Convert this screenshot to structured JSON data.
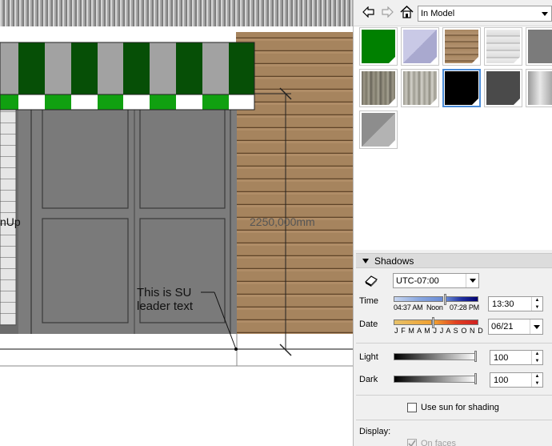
{
  "viewport": {
    "leader_text_line1": "This is SU",
    "leader_text_line2": "leader text",
    "dimension_label": "2250,000mm",
    "partial_label": "nUp"
  },
  "materials": {
    "collection": "In Model",
    "swatches": [
      {
        "name": "green",
        "color": "#008000"
      },
      {
        "name": "lavender",
        "color": "#b5b5da"
      },
      {
        "name": "wood",
        "color": "#a58463"
      },
      {
        "name": "siding",
        "color": "#e2e2e2"
      },
      {
        "name": "gray-partial",
        "color": "#7b7b7b"
      },
      {
        "name": "stone-1",
        "color": "#8a8676"
      },
      {
        "name": "stone-2",
        "color": "#b9b7ae"
      },
      {
        "name": "black",
        "color": "#000000"
      },
      {
        "name": "dark-gray",
        "color": "#4a4a4a"
      },
      {
        "name": "metal",
        "color": "#c5c5c5"
      },
      {
        "name": "gray",
        "color": "#8d8d8d"
      }
    ]
  },
  "shadows": {
    "title": "Shadows",
    "timezone": "UTC-07:00",
    "time_label": "Time",
    "time_marks": [
      "04:37 AM",
      "Noon",
      "07:28 PM"
    ],
    "time_value": "13:30",
    "date_label": "Date",
    "months": "J F M A M J J A S O N D",
    "date_value": "06/21",
    "light_label": "Light",
    "light_value": "100",
    "dark_label": "Dark",
    "dark_value": "100",
    "use_sun_label": "Use sun for shading",
    "display_label": "Display:",
    "on_faces_label": "On faces"
  }
}
